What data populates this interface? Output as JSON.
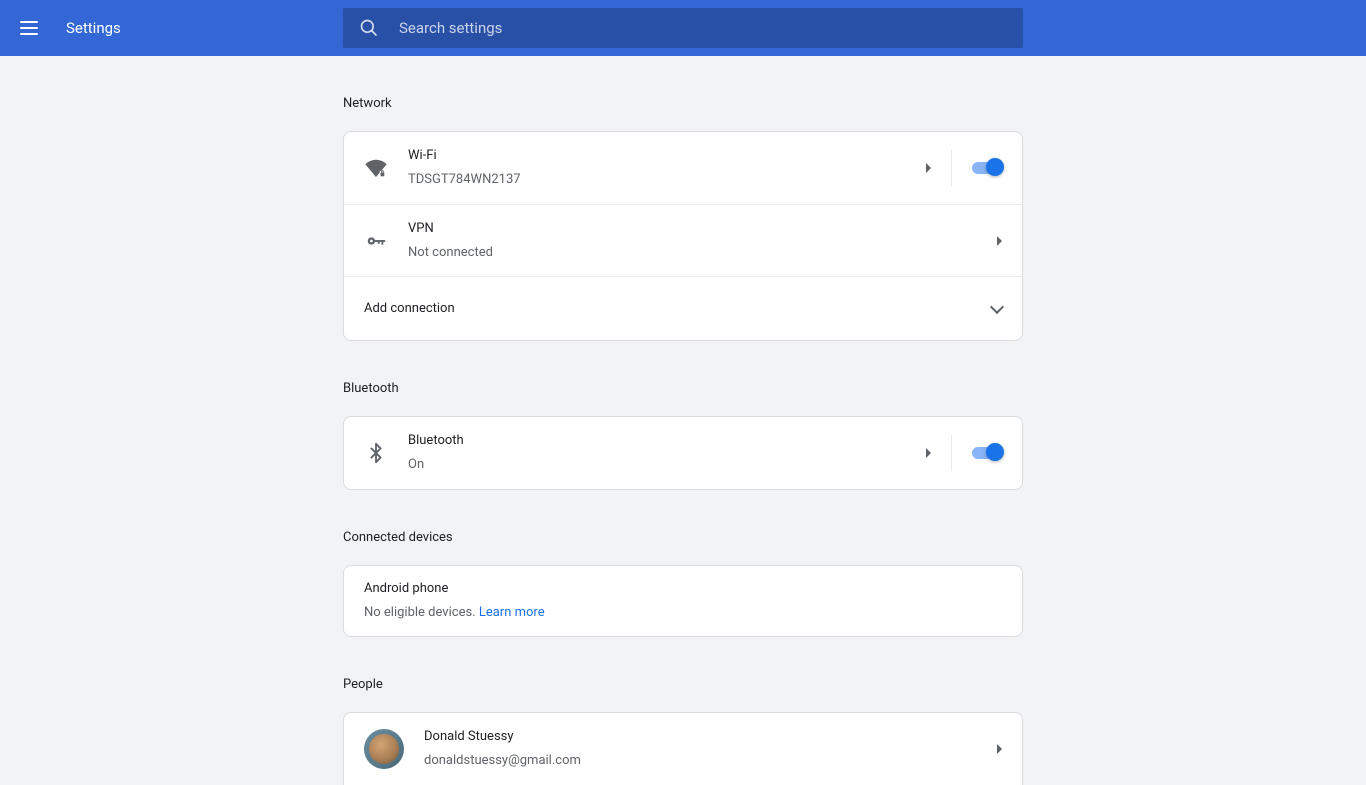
{
  "header": {
    "title": "Settings"
  },
  "search": {
    "placeholder": "Search settings",
    "value": ""
  },
  "sections": {
    "network": {
      "label": "Network",
      "wifi": {
        "title": "Wi-Fi",
        "subtitle": "TDSGT784WN2137"
      },
      "vpn": {
        "title": "VPN",
        "subtitle": "Not connected"
      },
      "add": {
        "title": "Add connection"
      }
    },
    "bluetooth": {
      "label": "Bluetooth",
      "row": {
        "title": "Bluetooth",
        "subtitle": "On"
      }
    },
    "connected": {
      "label": "Connected devices",
      "android": {
        "title": "Android phone",
        "subtitle_prefix": "No eligible devices. ",
        "link": "Learn more"
      }
    },
    "people": {
      "label": "People",
      "user": {
        "name": "Donald Stuessy",
        "email": "donaldstuessy@gmail.com"
      }
    }
  }
}
